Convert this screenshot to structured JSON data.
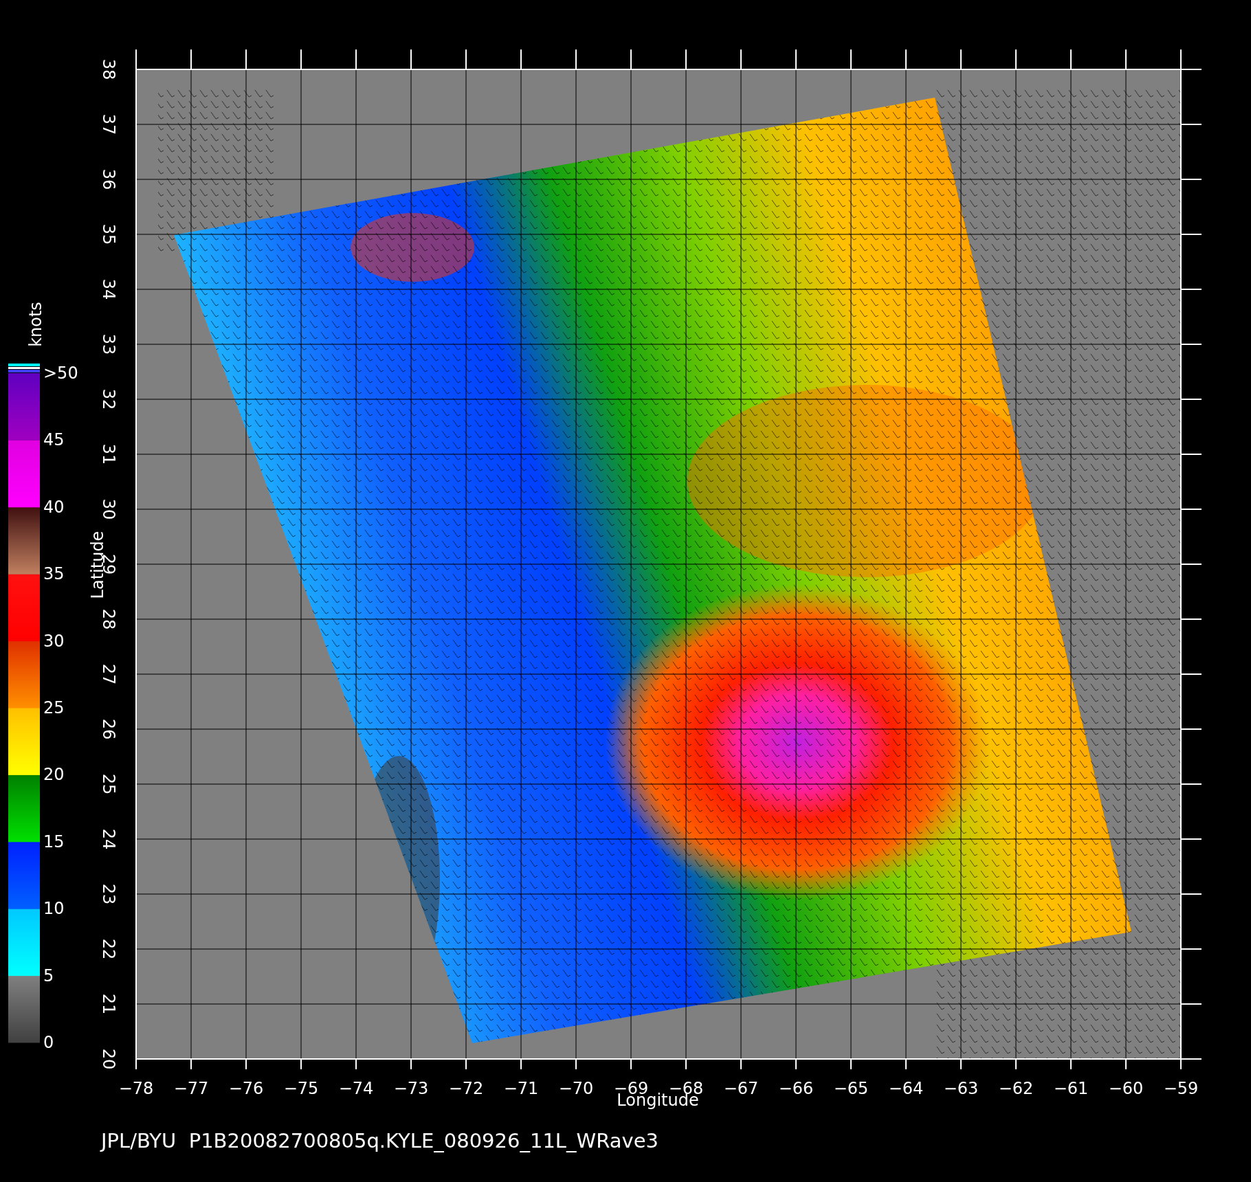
{
  "plot": {
    "xlabel": "Longitude",
    "ylabel": "Latitude",
    "xticks": [
      "−78",
      "−77",
      "−76",
      "−75",
      "−74",
      "−73",
      "−72",
      "−71",
      "−70",
      "−69",
      "−68",
      "−67",
      "−66",
      "−65",
      "−64",
      "−63",
      "−62",
      "−61",
      "−60",
      "−59"
    ],
    "yticks": [
      "20",
      "21",
      "22",
      "23",
      "24",
      "25",
      "26",
      "27",
      "28",
      "29",
      "30",
      "31",
      "32",
      "33",
      "34",
      "35",
      "36",
      "37",
      "38"
    ]
  },
  "colorbar": {
    "title": "knots",
    "labels": [
      ">50",
      "45",
      "40",
      "35",
      "30",
      "25",
      "20",
      "15",
      "10",
      "5",
      "0"
    ]
  },
  "caption": "JPL/BYU  P1B20082700805q.KYLE_080926_11L_WRave3"
}
